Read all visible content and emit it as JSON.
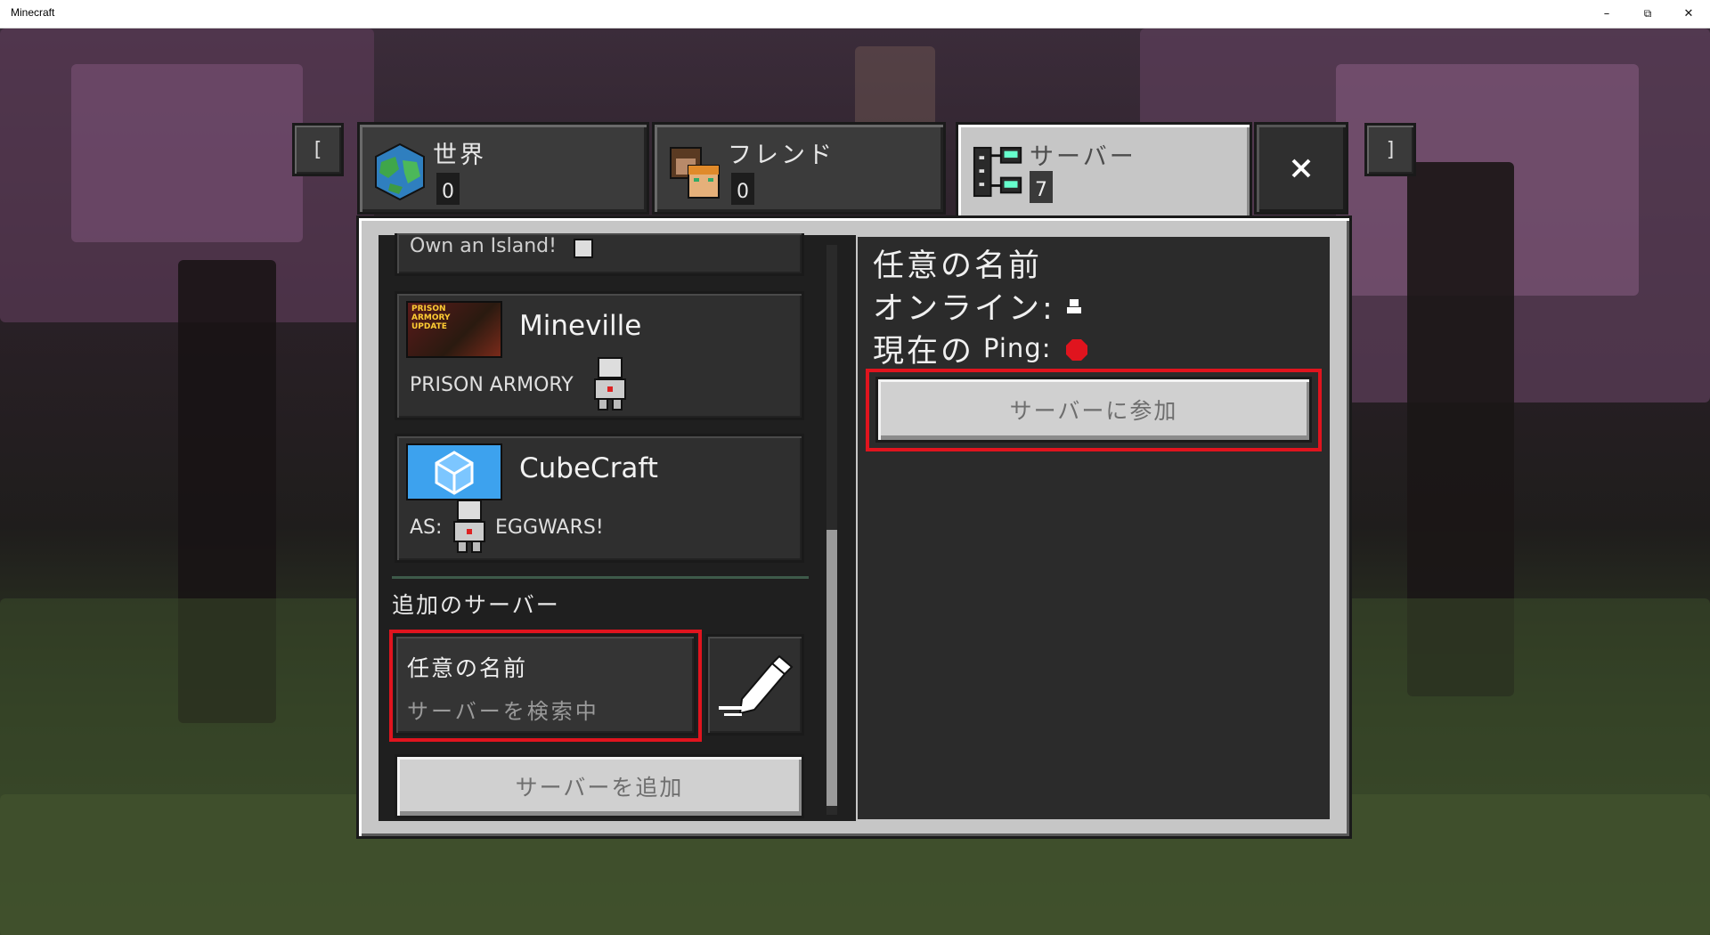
{
  "window": {
    "title": "Minecraft",
    "minimize": "–",
    "maximize": "⧉",
    "close": "✕"
  },
  "nav": {
    "left_bumper": "[",
    "right_bumper": "]",
    "close_icon": "close-icon"
  },
  "tabs": [
    {
      "label": "世界",
      "count": "0",
      "icon": "globe-icon"
    },
    {
      "label": "フレンド",
      "count": "0",
      "icon": "friends-icon"
    },
    {
      "label": "サーバー",
      "count": "7",
      "icon": "server-icon",
      "active": true
    }
  ],
  "server_list": {
    "partial_item": "Own an Island!",
    "items": [
      {
        "name": "Mineville",
        "subtitle": "PRISON ARMORY",
        "thumb_text": "PRISON ARMORY UPDATE"
      },
      {
        "name": "CubeCraft",
        "subtitle_prefix": "AS:",
        "subtitle_suffix": "EGGWARS!"
      }
    ],
    "additional_heading": "追加のサーバー",
    "additional_server": {
      "name": "任意の名前",
      "status": "サーバーを検索中"
    },
    "add_server_button": "サーバーを追加"
  },
  "details": {
    "name": "任意の名前",
    "online_label": "オンライン:",
    "ping_label_jp": "現在の",
    "ping_label": "Ping:",
    "join_button": "サーバーに参加"
  },
  "colors": {
    "highlight": "#e0141e",
    "panel": "#c6c6c6"
  }
}
